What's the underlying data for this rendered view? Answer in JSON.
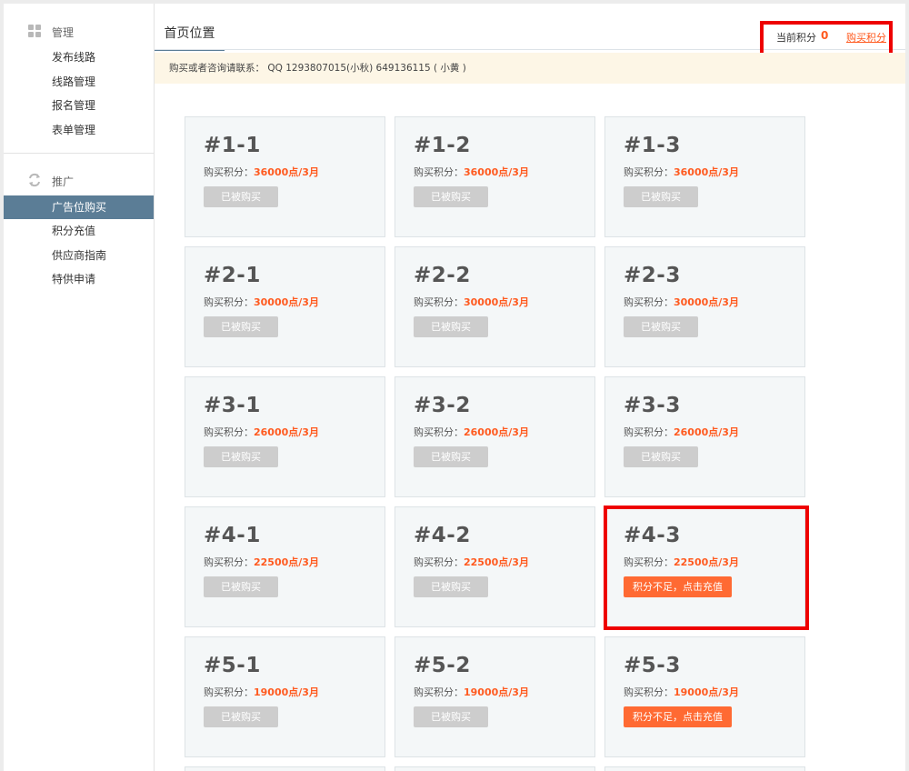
{
  "sidebar": {
    "groups": [
      {
        "label": "管理",
        "icon": "grid-icon",
        "items": [
          {
            "label": "发布线路"
          },
          {
            "label": "线路管理"
          },
          {
            "label": "报名管理"
          },
          {
            "label": "表单管理"
          }
        ]
      },
      {
        "label": "推广",
        "icon": "refresh-icon",
        "items": [
          {
            "label": "广告位购买",
            "active": true
          },
          {
            "label": "积分充值"
          },
          {
            "label": "供应商指南"
          },
          {
            "label": "特供申请"
          }
        ]
      }
    ],
    "active_color": "#5b7d96"
  },
  "header": {
    "tab_title": "首页位置",
    "points_label": "当前积分",
    "points_value": "0",
    "buy_points_link": "购买积分"
  },
  "notice": "购买或者咨询请联系：  QQ 1293807015(小秋) 649136115 ( 小黄 )",
  "cards": [
    {
      "slot": "#1-1",
      "price_label": "购买积分：",
      "price": "36000点/3月",
      "button": "已被购买",
      "status": "sold"
    },
    {
      "slot": "#1-2",
      "price_label": "购买积分：",
      "price": "36000点/3月",
      "button": "已被购买",
      "status": "sold"
    },
    {
      "slot": "#1-3",
      "price_label": "购买积分：",
      "price": "36000点/3月",
      "button": "已被购买",
      "status": "sold"
    },
    {
      "slot": "#2-1",
      "price_label": "购买积分：",
      "price": "30000点/3月",
      "button": "已被购买",
      "status": "sold"
    },
    {
      "slot": "#2-2",
      "price_label": "购买积分：",
      "price": "30000点/3月",
      "button": "已被购买",
      "status": "sold"
    },
    {
      "slot": "#2-3",
      "price_label": "购买积分：",
      "price": "30000点/3月",
      "button": "已被购买",
      "status": "sold"
    },
    {
      "slot": "#3-1",
      "price_label": "购买积分：",
      "price": "26000点/3月",
      "button": "已被购买",
      "status": "sold"
    },
    {
      "slot": "#3-2",
      "price_label": "购买积分：",
      "price": "26000点/3月",
      "button": "已被购买",
      "status": "sold"
    },
    {
      "slot": "#3-3",
      "price_label": "购买积分：",
      "price": "26000点/3月",
      "button": "已被购买",
      "status": "sold"
    },
    {
      "slot": "#4-1",
      "price_label": "购买积分：",
      "price": "22500点/3月",
      "button": "已被购买",
      "status": "sold"
    },
    {
      "slot": "#4-2",
      "price_label": "购买积分：",
      "price": "22500点/3月",
      "button": "已被购买",
      "status": "sold"
    },
    {
      "slot": "#4-3",
      "price_label": "购买积分：",
      "price": "22500点/3月",
      "button": "积分不足，点击充值",
      "status": "recharge"
    },
    {
      "slot": "#5-1",
      "price_label": "购买积分：",
      "price": "19000点/3月",
      "button": "已被购买",
      "status": "sold"
    },
    {
      "slot": "#5-2",
      "price_label": "购买积分：",
      "price": "19000点/3月",
      "button": "已被购买",
      "status": "sold"
    },
    {
      "slot": "#5-3",
      "price_label": "购买积分：",
      "price": "19000点/3月",
      "button": "积分不足，点击充值",
      "status": "recharge"
    }
  ],
  "colors": {
    "accent": "#ff5a1f",
    "sold_button": "#cdcdcd",
    "recharge_button": "#ff6a33",
    "highlight": "#ee0000"
  }
}
